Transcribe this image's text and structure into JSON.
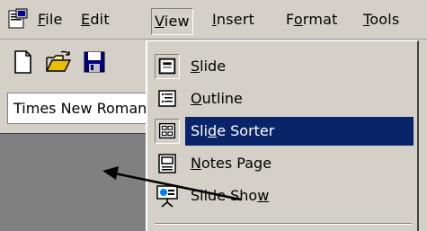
{
  "menubar": {
    "items": [
      {
        "label_acc": "F",
        "label_rest": "ile"
      },
      {
        "label_acc": "E",
        "label_rest": "dit"
      },
      {
        "label_acc": "V",
        "label_rest": "iew"
      },
      {
        "label_acc": "I",
        "label_rest": "nsert"
      },
      {
        "label_pre": "F",
        "label_acc": "o",
        "label_rest": "rmat"
      },
      {
        "label_acc": "T",
        "label_rest": "ools"
      }
    ]
  },
  "toolbar": {
    "buttons": [
      "new-document-icon",
      "open-folder-icon",
      "save-icon"
    ]
  },
  "font_box": {
    "value": "Times New Roman"
  },
  "view_menu": {
    "items": [
      {
        "pre": "",
        "acc": "S",
        "rest": "lide",
        "icon": "slide-view-icon",
        "pressed": true
      },
      {
        "pre": "",
        "acc": "O",
        "rest": "utline",
        "icon": "outline-view-icon",
        "pressed": false
      },
      {
        "pre": "Sli",
        "acc": "d",
        "rest": "e Sorter",
        "icon": "slide-sorter-icon",
        "pressed": true,
        "highlighted": true
      },
      {
        "pre": "",
        "acc": "N",
        "rest": "otes Page",
        "icon": "notes-page-icon",
        "pressed": false
      },
      {
        "pre": "Slide Sho",
        "acc": "w",
        "rest": "",
        "icon": "slide-show-icon",
        "pressed": false
      }
    ]
  },
  "colors": {
    "face": "#d4d0c8",
    "highlight": "#0a246a",
    "workspace": "#808080"
  }
}
